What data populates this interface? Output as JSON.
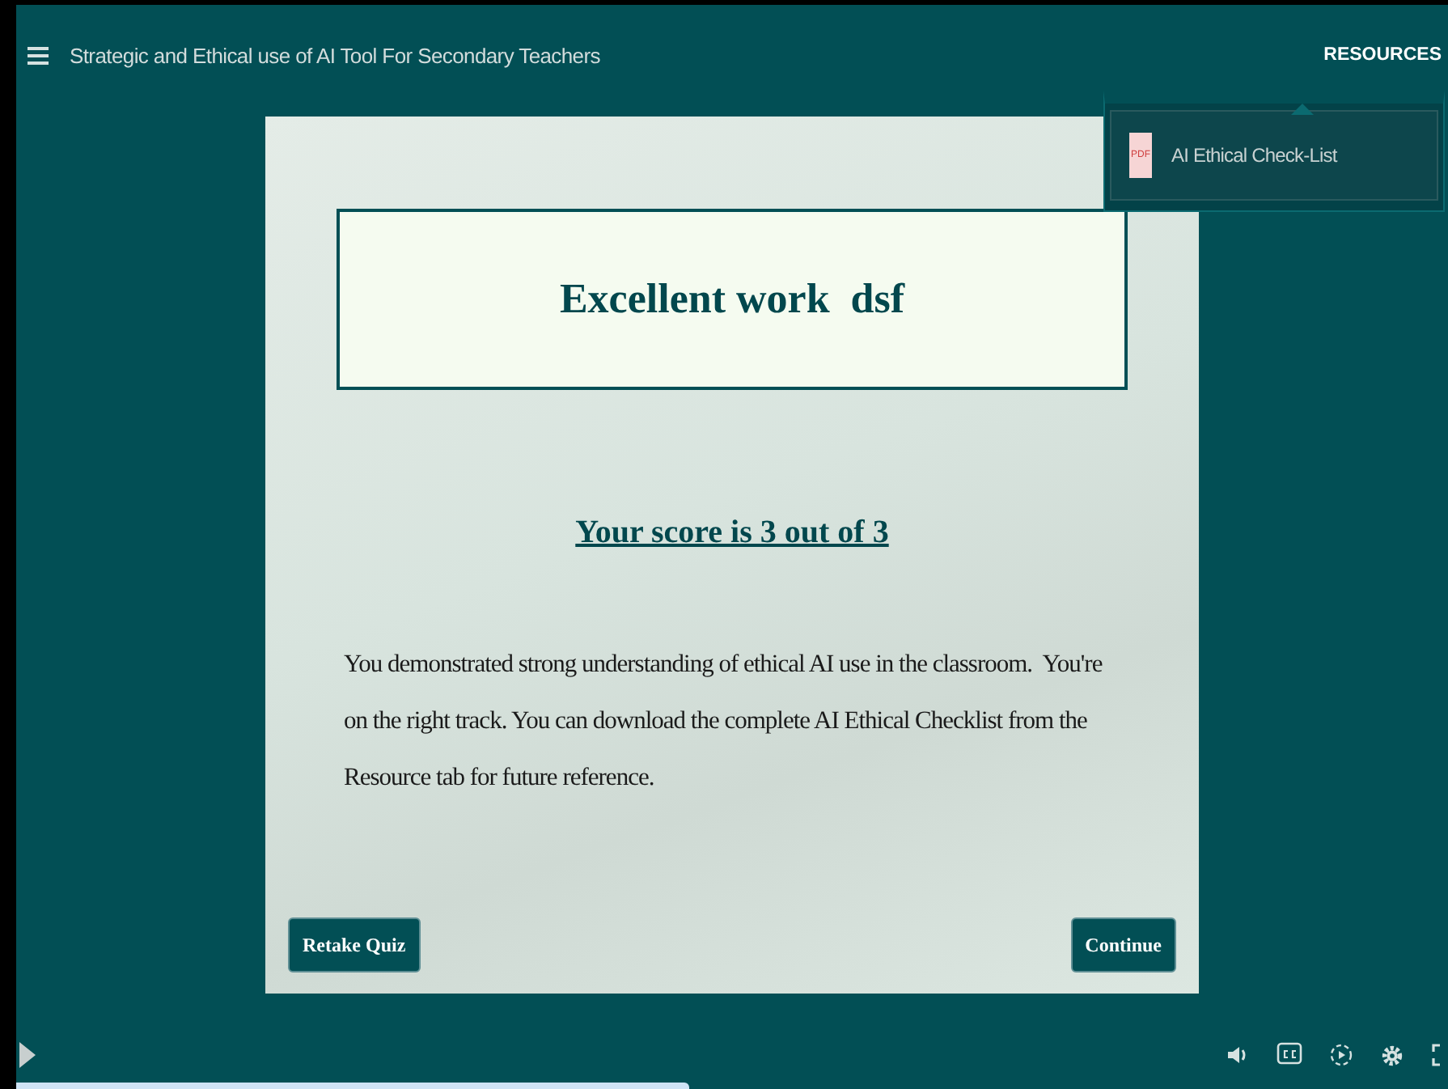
{
  "header": {
    "title": "Strategic and Ethical use of AI Tool For Secondary Teachers",
    "resources_label": "RESOURCES"
  },
  "resources_menu": {
    "items": [
      {
        "label": "AI Ethical Check-List",
        "file_type": "PDF"
      }
    ]
  },
  "slide": {
    "heading": "Excellent work  dsf",
    "score": "Your score is 3 out of 3",
    "message": "You demonstrated strong understanding of ethical AI use in the classroom.  You're on the right track. You can download the complete AI Ethical Checklist from the Resource tab for future reference.",
    "buttons": [
      "Retake Quiz",
      "Continue"
    ]
  },
  "player": {
    "progress": {
      "level": 0.47
    }
  }
}
